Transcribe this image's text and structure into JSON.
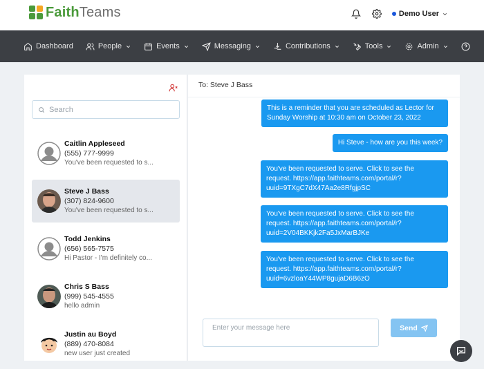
{
  "brand": {
    "name_part1": "Faith",
    "name_part2": "Teams",
    "logo_colors": [
      "#4a9a3a",
      "#f5a623",
      "#e8e8e8",
      "#4a9a3a"
    ]
  },
  "header": {
    "user_name": "Demo User",
    "status_color": "#1a56db"
  },
  "nav": {
    "items": [
      {
        "label": "Dashboard",
        "icon": "home-icon",
        "has_dropdown": false
      },
      {
        "label": "People",
        "icon": "people-icon",
        "has_dropdown": true
      },
      {
        "label": "Events",
        "icon": "calendar-icon",
        "has_dropdown": true
      },
      {
        "label": "Messaging",
        "icon": "send-icon",
        "has_dropdown": true
      },
      {
        "label": "Contributions",
        "icon": "hand-coins-icon",
        "has_dropdown": true
      },
      {
        "label": "Tools",
        "icon": "tools-icon",
        "has_dropdown": true
      },
      {
        "label": "Admin",
        "icon": "gear-icon",
        "has_dropdown": true
      }
    ]
  },
  "search": {
    "placeholder": "Search"
  },
  "contacts": [
    {
      "name": "Caitlin Appleseed",
      "phone": "(555) 777-9999",
      "preview": "You've been requested to s...",
      "avatar": "default-avatar",
      "active": false
    },
    {
      "name": "Steve J Bass",
      "phone": "(307) 824-9600",
      "preview": "You've been requested to s...",
      "avatar": "photo-steve",
      "active": true
    },
    {
      "name": "Todd Jenkins",
      "phone": "(656) 565-7575",
      "preview": "Hi Pastor - I'm definitely co...",
      "avatar": "default-avatar",
      "active": false
    },
    {
      "name": "Chris S Bass",
      "phone": "(999) 545-4555",
      "preview": "hello admin",
      "avatar": "photo-chris",
      "active": false
    },
    {
      "name": "Justin au Boyd",
      "phone": "(889) 470-8084",
      "preview": "new user just created",
      "avatar": "cartoon-avatar",
      "active": false
    }
  ],
  "conversation": {
    "to_label": "To: Steve J Bass",
    "messages": [
      {
        "line1": "This is a reminder that you are scheduled as Lector for",
        "line2": "Sunday Worship at 10:30 am on October 23, 2022",
        "line3": ""
      },
      {
        "line1": "Hi Steve - how are you this week?",
        "line2": "",
        "line3": ""
      },
      {
        "line1": "You've been requested to serve. Click to see the",
        "line2": "request. https://app.faithteams.com/portal/r?",
        "line3": "uuid=9TXgC7dX47Aa2e8RfgjpSC"
      },
      {
        "line1": "You've been requested to serve. Click to see the",
        "line2": "request. https://app.faithteams.com/portal/r?",
        "line3": "uuid=2V04BKKjk2Fa5JxMarBJKe"
      },
      {
        "line1": "You've been requested to serve. Click to see the",
        "line2": "request. https://app.faithteams.com/portal/r?",
        "line3": "uuid=6vzloaY44WP8gujaD6B6zO"
      }
    ],
    "bubble_color": "#1a99f0"
  },
  "compose": {
    "placeholder": "Enter your message here",
    "send_label": "Send"
  }
}
